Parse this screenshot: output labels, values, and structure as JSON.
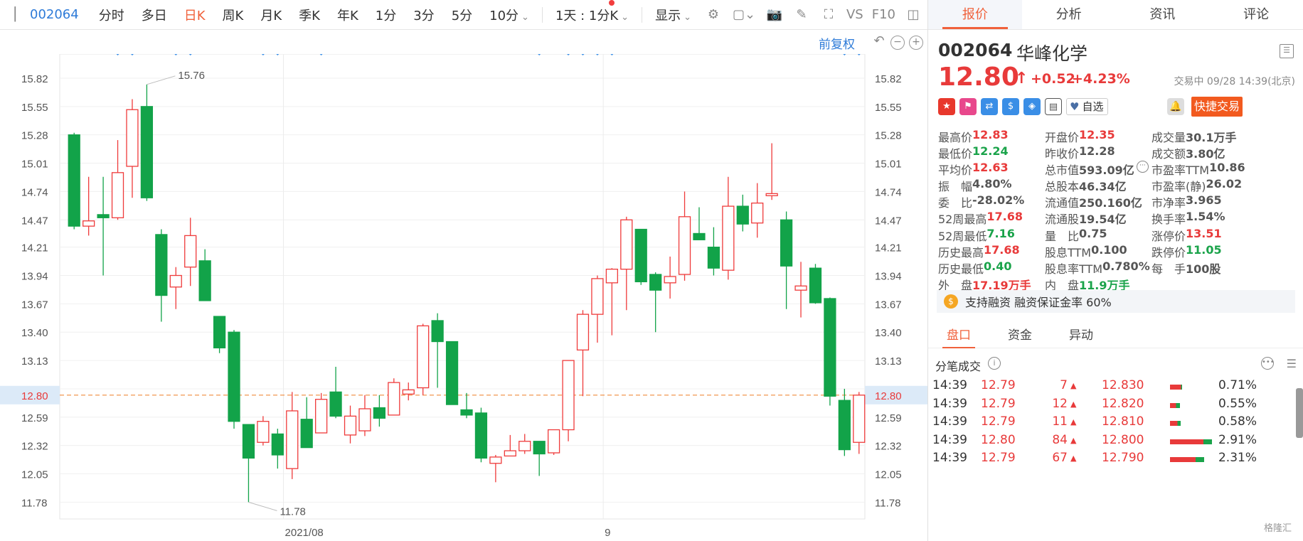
{
  "toolbar": {
    "code": "002064",
    "periods": [
      "分时",
      "多日",
      "日K",
      "周K",
      "月K",
      "季K",
      "年K",
      "1分",
      "3分",
      "5分",
      "10分"
    ],
    "active_period": 2,
    "interval_select": "1天 : 1分K",
    "display_label": "显示",
    "vs_label": "VS",
    "f10_label": "F10"
  },
  "fuquan": {
    "label": "前复权"
  },
  "chart_data": {
    "type": "candlestick",
    "y_ticks": [
      15.82,
      15.55,
      15.28,
      15.01,
      14.74,
      14.47,
      14.21,
      13.94,
      13.67,
      13.4,
      13.13,
      12.86,
      12.59,
      12.32,
      12.05,
      11.78
    ],
    "ylim": [
      11.62,
      16.05
    ],
    "current_price": 12.8,
    "x_labels": [
      {
        "text": "2021/08",
        "index": 15
      },
      {
        "text": "9",
        "index": 37
      }
    ],
    "max_label": "15.76",
    "min_label": "11.78",
    "candles": [
      {
        "o": 15.28,
        "h": 15.3,
        "l": 14.38,
        "c": 14.41
      },
      {
        "o": 14.41,
        "h": 14.88,
        "l": 14.32,
        "c": 14.46
      },
      {
        "o": 14.52,
        "h": 14.88,
        "l": 13.94,
        "c": 14.49
      },
      {
        "o": 14.49,
        "h": 15.23,
        "l": 14.47,
        "c": 14.92
      },
      {
        "o": 14.98,
        "h": 15.62,
        "l": 14.68,
        "c": 15.52
      },
      {
        "o": 15.55,
        "h": 15.76,
        "l": 14.65,
        "c": 14.68
      },
      {
        "o": 14.33,
        "h": 14.38,
        "l": 13.5,
        "c": 13.75
      },
      {
        "o": 13.83,
        "h": 14.02,
        "l": 13.62,
        "c": 13.94
      },
      {
        "o": 14.02,
        "h": 14.49,
        "l": 13.84,
        "c": 14.32
      },
      {
        "o": 14.08,
        "h": 14.19,
        "l": 13.7,
        "c": 13.7
      },
      {
        "o": 13.55,
        "h": 13.55,
        "l": 13.2,
        "c": 13.25
      },
      {
        "o": 13.4,
        "h": 13.42,
        "l": 12.48,
        "c": 12.55
      },
      {
        "o": 12.52,
        "h": 12.52,
        "l": 11.78,
        "c": 12.2
      },
      {
        "o": 12.35,
        "h": 12.6,
        "l": 12.32,
        "c": 12.55
      },
      {
        "o": 12.43,
        "h": 12.48,
        "l": 12.1,
        "c": 12.23
      },
      {
        "o": 12.1,
        "h": 12.83,
        "l": 12.0,
        "c": 12.65
      },
      {
        "o": 12.57,
        "h": 12.78,
        "l": 12.3,
        "c": 12.3
      },
      {
        "o": 12.44,
        "h": 12.82,
        "l": 12.44,
        "c": 12.76
      },
      {
        "o": 12.83,
        "h": 13.07,
        "l": 12.58,
        "c": 12.6
      },
      {
        "o": 12.42,
        "h": 12.7,
        "l": 12.34,
        "c": 12.6
      },
      {
        "o": 12.46,
        "h": 12.8,
        "l": 12.41,
        "c": 12.67
      },
      {
        "o": 12.68,
        "h": 12.8,
        "l": 12.5,
        "c": 12.58
      },
      {
        "o": 12.61,
        "h": 12.96,
        "l": 12.61,
        "c": 12.92
      },
      {
        "o": 12.81,
        "h": 12.92,
        "l": 12.75,
        "c": 12.85
      },
      {
        "o": 12.87,
        "h": 13.48,
        "l": 12.8,
        "c": 13.46
      },
      {
        "o": 13.51,
        "h": 13.58,
        "l": 12.87,
        "c": 13.31
      },
      {
        "o": 13.31,
        "h": 13.31,
        "l": 12.8,
        "c": 12.71
      },
      {
        "o": 12.66,
        "h": 12.82,
        "l": 12.58,
        "c": 12.61
      },
      {
        "o": 12.63,
        "h": 12.68,
        "l": 12.16,
        "c": 12.2
      },
      {
        "o": 12.15,
        "h": 12.23,
        "l": 11.97,
        "c": 12.21
      },
      {
        "o": 12.22,
        "h": 12.42,
        "l": 12.22,
        "c": 12.27
      },
      {
        "o": 12.27,
        "h": 12.43,
        "l": 12.24,
        "c": 12.36
      },
      {
        "o": 12.36,
        "h": 12.36,
        "l": 12.03,
        "c": 12.24
      },
      {
        "o": 12.25,
        "h": 12.47,
        "l": 12.23,
        "c": 12.47
      },
      {
        "o": 12.47,
        "h": 13.13,
        "l": 12.36,
        "c": 13.13
      },
      {
        "o": 13.23,
        "h": 13.61,
        "l": 12.79,
        "c": 13.57
      },
      {
        "o": 13.57,
        "h": 13.94,
        "l": 13.3,
        "c": 13.91
      },
      {
        "o": 13.87,
        "h": 14.01,
        "l": 13.37,
        "c": 14.0
      },
      {
        "o": 14.0,
        "h": 14.5,
        "l": 13.61,
        "c": 14.47
      },
      {
        "o": 14.38,
        "h": 14.38,
        "l": 13.85,
        "c": 13.88
      },
      {
        "o": 13.95,
        "h": 13.97,
        "l": 13.4,
        "c": 13.8
      },
      {
        "o": 13.87,
        "h": 14.12,
        "l": 13.72,
        "c": 13.93
      },
      {
        "o": 13.95,
        "h": 14.74,
        "l": 13.89,
        "c": 14.5
      },
      {
        "o": 14.34,
        "h": 14.59,
        "l": 14.28,
        "c": 14.28
      },
      {
        "o": 14.21,
        "h": 14.4,
        "l": 13.94,
        "c": 14.01
      },
      {
        "o": 13.99,
        "h": 14.88,
        "l": 13.9,
        "c": 14.6
      },
      {
        "o": 14.6,
        "h": 14.71,
        "l": 14.36,
        "c": 14.43
      },
      {
        "o": 14.44,
        "h": 14.82,
        "l": 14.3,
        "c": 14.63
      },
      {
        "o": 14.7,
        "h": 15.2,
        "l": 14.66,
        "c": 14.72
      },
      {
        "o": 14.47,
        "h": 14.55,
        "l": 13.62,
        "c": 14.03
      },
      {
        "o": 13.8,
        "h": 14.07,
        "l": 13.54,
        "c": 13.84
      },
      {
        "o": 14.01,
        "h": 14.05,
        "l": 13.67,
        "c": 13.68
      },
      {
        "o": 13.72,
        "h": 13.73,
        "l": 12.7,
        "c": 12.79
      },
      {
        "o": 12.75,
        "h": 12.86,
        "l": 12.22,
        "c": 12.28
      },
      {
        "o": 12.35,
        "h": 12.83,
        "l": 12.24,
        "c": 12.8
      }
    ],
    "markers": [
      3,
      4,
      7,
      8,
      13,
      14,
      17,
      32,
      34,
      35,
      36,
      37,
      53,
      54
    ]
  },
  "stock": {
    "code": "002064",
    "name": "华峰化学",
    "price": "12.80",
    "arrow": "↑",
    "change": "+0.52",
    "percent": "+4.23%",
    "status": "交易中 09/28 14:39(北京)",
    "watch_label": "自选",
    "quick_trade": "快捷交易"
  },
  "right_tabs": [
    "报价",
    "分析",
    "资讯",
    "评论"
  ],
  "quote_rows": [
    [
      [
        "最高价",
        "12.83",
        "up"
      ],
      [
        "开盘价",
        "12.35",
        "up"
      ],
      [
        "成交量",
        "30.1万手",
        "gr"
      ]
    ],
    [
      [
        "最低价",
        "12.24",
        "dn"
      ],
      [
        "昨收价",
        "12.28",
        "gr"
      ],
      [
        "成交额",
        "3.80亿",
        "gr"
      ]
    ],
    [
      [
        "平均价",
        "12.63",
        "up"
      ],
      [
        "总市值",
        "593.09亿",
        "gr"
      ],
      [
        "市盈率TTM",
        "10.86",
        "gr"
      ]
    ],
    [
      [
        "振　幅",
        "4.80%",
        "gr"
      ],
      [
        "总股本",
        "46.34亿",
        "gr"
      ],
      [
        "市盈率(静)",
        "26.02",
        "gr"
      ]
    ],
    [
      [
        "委　比",
        "-28.02%",
        "gr"
      ],
      [
        "流通值",
        "250.160亿",
        "gr"
      ],
      [
        "市净率",
        "3.965",
        "gr"
      ]
    ],
    [
      [
        "52周最高",
        "17.68",
        "up"
      ],
      [
        "流通股",
        "19.54亿",
        "gr"
      ],
      [
        "换手率",
        "1.54%",
        "gr"
      ]
    ],
    [
      [
        "52周最低",
        "7.16",
        "dn"
      ],
      [
        "量　比",
        "0.75",
        "gr"
      ],
      [
        "涨停价",
        "13.51",
        "up"
      ]
    ],
    [
      [
        "历史最高",
        "17.68",
        "up"
      ],
      [
        "股息TTM",
        "0.100",
        "gr"
      ],
      [
        "跌停价",
        "11.05",
        "dn"
      ]
    ],
    [
      [
        "历史最低",
        "0.40",
        "dn"
      ],
      [
        "股息率TTM",
        "0.780%",
        "gr"
      ],
      [
        "每　手",
        "100股",
        "gr"
      ]
    ],
    [
      [
        "外　盘",
        "17.19万手",
        "up"
      ],
      [
        "内　盘",
        "11.9万手",
        "dn"
      ],
      [
        "",
        "",
        " "
      ]
    ]
  ],
  "margin": {
    "text": "支持融资 融资保证金率 60%"
  },
  "sub_tabs": [
    "盘口",
    "资金",
    "异动"
  ],
  "tick_title": "分笔成交",
  "ticks": [
    {
      "time": "14:39",
      "price": "12.79",
      "vol": "7",
      "lvl": "12.830",
      "pct": "0.71%",
      "r": 0.9,
      "g": 0.1
    },
    {
      "time": "14:39",
      "price": "12.79",
      "vol": "12",
      "lvl": "12.820",
      "pct": "0.55%",
      "r": 0.6,
      "g": 0.4
    },
    {
      "time": "14:39",
      "price": "12.79",
      "vol": "11",
      "lvl": "12.810",
      "pct": "0.58%",
      "r": 0.7,
      "g": 0.3
    },
    {
      "time": "14:39",
      "price": "12.80",
      "vol": "84",
      "lvl": "12.800",
      "pct": "2.91%",
      "r": 0.8,
      "g": 0.2
    },
    {
      "time": "14:39",
      "price": "12.79",
      "vol": "67",
      "lvl": "12.790",
      "pct": "2.31%",
      "r": 0.75,
      "g": 0.25
    }
  ],
  "watermark": "格隆汇"
}
